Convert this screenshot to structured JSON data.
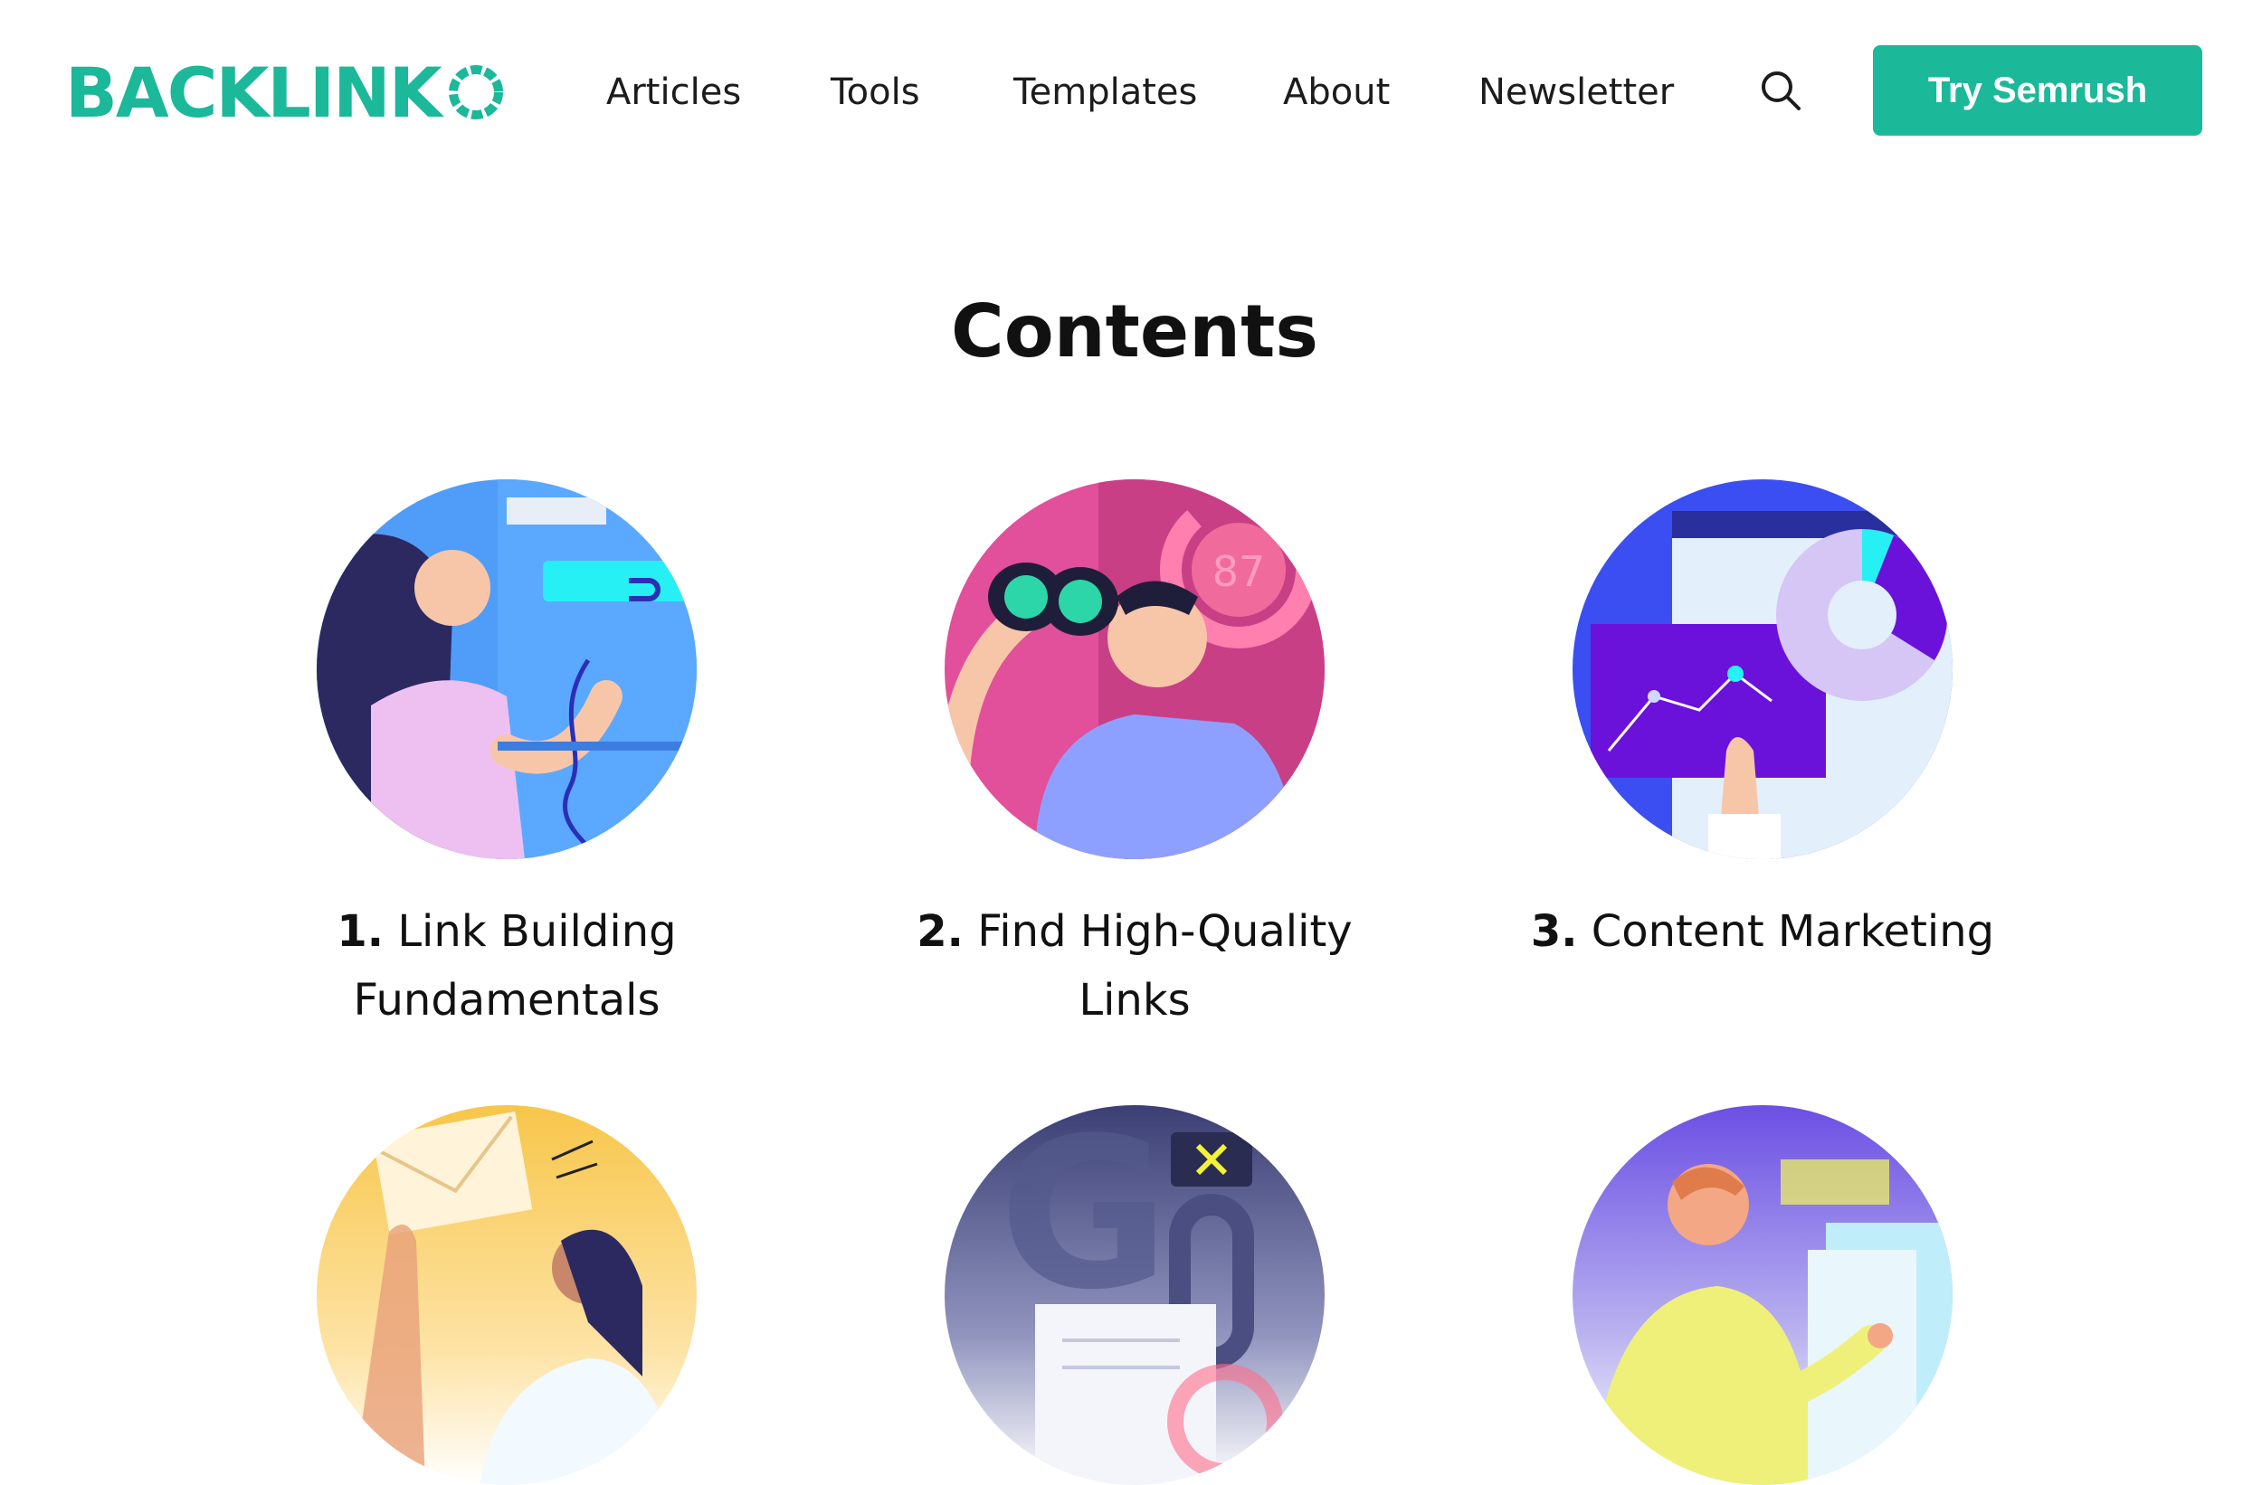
{
  "brand": {
    "logo_text": "BACKLINK",
    "accent": "#1bb89a"
  },
  "nav": {
    "items": [
      {
        "label": "Articles"
      },
      {
        "label": "Tools"
      },
      {
        "label": "Templates"
      },
      {
        "label": "About"
      },
      {
        "label": "Newsletter"
      }
    ],
    "search_icon": "search-icon",
    "cta_label": "Try Semrush"
  },
  "contents": {
    "title": "Contents",
    "cards": [
      {
        "number": "1.",
        "title_line1": "Link Building",
        "title_line2": "Fundamentals",
        "icon": "link-building-illustration"
      },
      {
        "number": "2.",
        "title_line1": "Find High-Quality",
        "title_line2": "Links",
        "icon": "binoculars-illustration",
        "score": "87"
      },
      {
        "number": "3.",
        "title_line1": "Content Marketing",
        "title_line2": "",
        "icon": "analytics-chart-illustration"
      },
      {
        "icon": "email-outreach-illustration"
      },
      {
        "icon": "google-penalty-illustration"
      },
      {
        "icon": "presentation-illustration"
      }
    ]
  }
}
